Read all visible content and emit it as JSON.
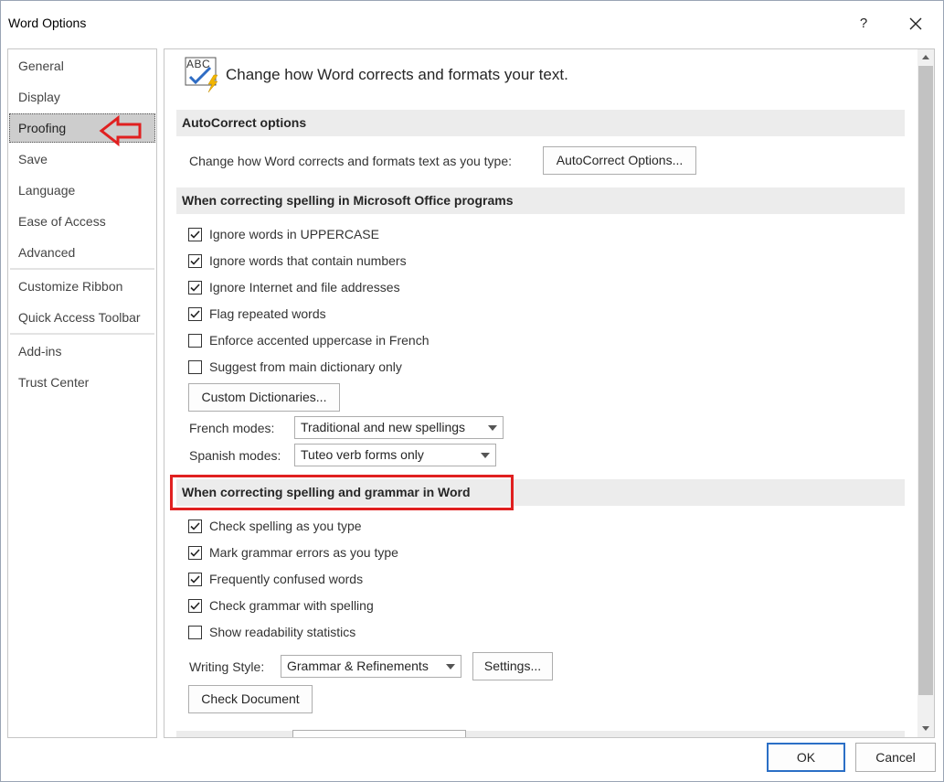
{
  "window": {
    "title": "Word Options",
    "help": "?"
  },
  "sidebar": {
    "items": [
      {
        "label": "General"
      },
      {
        "label": "Display"
      },
      {
        "label": "Proofing"
      },
      {
        "label": "Save"
      },
      {
        "label": "Language"
      },
      {
        "label": "Ease of Access"
      },
      {
        "label": "Advanced"
      },
      {
        "label": "Customize Ribbon"
      },
      {
        "label": "Quick Access Toolbar"
      },
      {
        "label": "Add-ins"
      },
      {
        "label": "Trust Center"
      }
    ],
    "active": "Proofing"
  },
  "main": {
    "header_icon_text": "ABC",
    "header": "Change how Word corrects and formats your text.",
    "autocorrect": {
      "title": "AutoCorrect options",
      "desc": "Change how Word corrects and formats text as you type:",
      "button": "AutoCorrect Options..."
    },
    "office": {
      "title": "When correcting spelling in Microsoft Office programs",
      "checkboxes": [
        {
          "label": "Ignore words in UPPERCASE",
          "checked": true
        },
        {
          "label": "Ignore words that contain numbers",
          "checked": true
        },
        {
          "label": "Ignore Internet and file addresses",
          "checked": true
        },
        {
          "label": "Flag repeated words",
          "checked": true
        },
        {
          "label": "Enforce accented uppercase in French",
          "checked": false
        },
        {
          "label": "Suggest from main dictionary only",
          "checked": false
        }
      ],
      "custom_dict_button": "Custom Dictionaries...",
      "french_label": "French modes:",
      "french_value": "Traditional and new spellings",
      "spanish_label": "Spanish modes:",
      "spanish_value": "Tuteo verb forms only"
    },
    "word": {
      "title": "When correcting spelling and grammar in Word",
      "checkboxes": [
        {
          "label": "Check spelling as you type",
          "checked": true
        },
        {
          "label": "Mark grammar errors as you type",
          "checked": true
        },
        {
          "label": "Frequently confused words",
          "checked": true
        },
        {
          "label": "Check grammar with spelling",
          "checked": true
        },
        {
          "label": "Show readability statistics",
          "checked": false
        }
      ],
      "writing_style_label": "Writing Style:",
      "writing_style_value": "Grammar & Refinements",
      "settings_button": "Settings...",
      "check_document_button": "Check Document"
    }
  },
  "footer": {
    "ok": "OK",
    "cancel": "Cancel"
  },
  "colors": {
    "annotation_red": "#e02020",
    "section_bg": "#ececec",
    "primary_border": "#2b6fc6"
  }
}
